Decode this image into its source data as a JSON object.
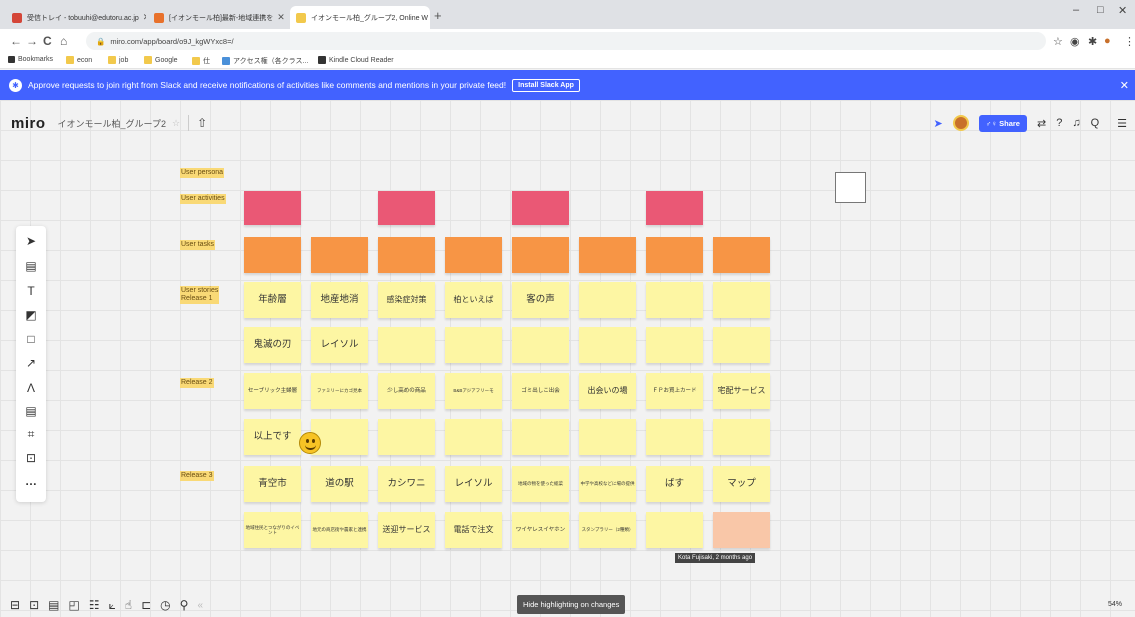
{
  "browser": {
    "tabs": [
      {
        "title": "受信トレイ - tobuuhi@edutoru.ac.jp",
        "color": "#d44638"
      },
      {
        "title": "[イオンモール柏]最新-地域連携を",
        "color": "#e8712b"
      },
      {
        "title": "イオンモール柏_グループ2, Online W",
        "color": "#f2c94c"
      }
    ],
    "new_tab": "+",
    "window_controls": {
      "minimize": "–",
      "maximize": "□",
      "close": "✕"
    },
    "nav": {
      "back": "←",
      "forward": "→",
      "reload": "C",
      "home": "⌂"
    },
    "url": "miro.com/app/board/o9J_kgWYxc8=/",
    "lock": "🔒",
    "extensions": [
      "☆",
      "◉",
      "✱",
      "●",
      "⋮"
    ],
    "bookmarks": [
      {
        "label": "Bookmarks",
        "color": "#333333"
      },
      {
        "label": "econ",
        "color": "#f2c94c"
      },
      {
        "label": "job",
        "color": "#f2c94c"
      },
      {
        "label": "Google",
        "color": "#f2c94c"
      },
      {
        "label": "仕",
        "color": "#f2c94c"
      },
      {
        "label": "アクセス権（各クラス...",
        "color": "#4a90d9"
      },
      {
        "label": "Kindle Cloud Reader",
        "color": "#333333"
      }
    ]
  },
  "banner": {
    "message": "Approve requests to join right from Slack and receive notifications of activities like comments and mentions in your private feed!",
    "button": "Install Slack App",
    "close": "✕"
  },
  "header": {
    "logo": "miro",
    "board_name": "イオンモール柏_グループ2",
    "star": "☆",
    "upload": "⇧",
    "share_label": "Share",
    "icons": [
      "⇄",
      "?",
      "♫",
      "Q",
      "☰"
    ]
  },
  "toolbar": [
    "➤",
    "▤",
    "T",
    "◩",
    "□",
    "↗",
    "Ʌ",
    "▤",
    "⌗",
    "⊡",
    "…"
  ],
  "row_labels": [
    {
      "text": "User persona"
    },
    {
      "text": "User activities"
    },
    {
      "text": "User tasks"
    },
    {
      "text": "User stories\nRelease 1"
    },
    {
      "text": "Release 2"
    },
    {
      "text": "Release 3"
    }
  ],
  "board": {
    "activities": [
      "",
      "",
      "",
      ""
    ],
    "tasks": [
      "",
      "",
      "",
      "",
      "",
      "",
      "",
      ""
    ],
    "release1_row1": [
      "年齢層",
      "地産地消",
      "感染症対策",
      "柏といえば",
      "客の声",
      "",
      "",
      ""
    ],
    "release1_row2": [
      "鬼滅の刃",
      "レイソル",
      "",
      "",
      "",
      "",
      "",
      ""
    ],
    "release2_row1": [
      "セーブリック主婦層",
      "ファミリーにカゴ見本",
      "少し高めの商品",
      "B&Bアジアフリーモ",
      "ゴミ出しこ出会",
      "出会いの場",
      "ＦＰお買上カード",
      "宅配サービス"
    ],
    "release2_row2": [
      "以上です",
      "",
      "",
      "",
      "",
      "",
      "",
      ""
    ],
    "release3_row1": [
      "青空市",
      "道の駅",
      "カシワニ",
      "レイソル",
      "地域の物を使った総菜",
      "中学や高校などに場の提供",
      "ばす",
      "マップ"
    ],
    "release3_row2": [
      "地域住民とつながりのイベント",
      "地元の商店街や農家と連携",
      "送迎サービス",
      "電話で注文",
      "ワイヤレスイヤホン",
      "スタンプラリー（2種類）",
      "",
      ""
    ]
  },
  "tooltip": "Kota Fujisaki, 2 months ago",
  "bottom_icons": [
    "⊟",
    "⊡",
    "▤",
    "◰",
    "☷",
    "⟀",
    "☝",
    "⊏",
    "◷",
    "⚲",
    "«"
  ],
  "hide_button": "Hide highlighting on changes",
  "zoom": "54%"
}
